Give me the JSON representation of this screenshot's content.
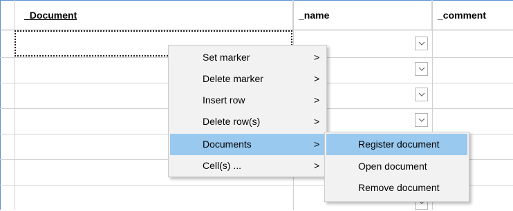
{
  "columns": {
    "document": "_Document",
    "name": "_name",
    "comment": "_comment"
  },
  "context_menu": {
    "items": [
      {
        "label": "Set marker",
        "arrow": ">"
      },
      {
        "label": "Delete marker",
        "arrow": ">"
      },
      {
        "label": "Insert row",
        "arrow": ">"
      },
      {
        "label": "Delete row(s)",
        "arrow": ">"
      },
      {
        "label": "Documents",
        "arrow": ">",
        "selected": true
      },
      {
        "label": "Cell(s) ...",
        "arrow": ">"
      }
    ]
  },
  "submenu": {
    "items": [
      {
        "label": "Register document",
        "selected": true
      },
      {
        "label": "Open document"
      },
      {
        "label": "Remove document"
      }
    ]
  },
  "colors": {
    "selection": "#99c9ef",
    "menu_bg": "#f2f2f2",
    "header_accent": "#5b8fd1"
  },
  "icons": {
    "dropdown": "chevron-down-icon",
    "submenu_arrow": "chevron-right"
  }
}
